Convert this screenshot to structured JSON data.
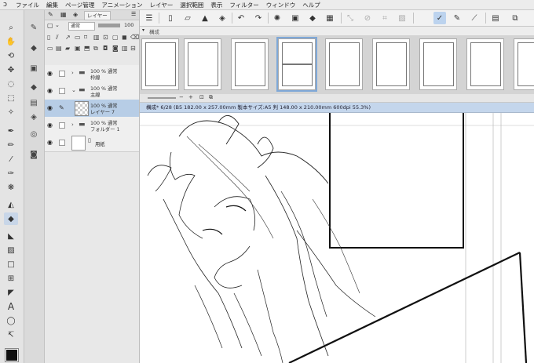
{
  "menu": [
    "ファイル",
    "編集",
    "ページ管理",
    "アニメーション",
    "レイヤー",
    "選択範囲",
    "表示",
    "フィルター",
    "ウィンドウ",
    "ヘルプ"
  ],
  "layer_panel": {
    "tab_label": "レイヤー",
    "blend_mode": "通常",
    "opacity": "100",
    "layers": [
      {
        "line1": "100 % 通常",
        "line2": "枠線",
        "type": "folder",
        "active": false
      },
      {
        "line1": "100 % 通常",
        "line2": "主線",
        "type": "folder",
        "active": false
      },
      {
        "line1": "100 % 通常",
        "line2": "レイヤー 7",
        "type": "raster",
        "active": true
      },
      {
        "line1": "100 % 通常",
        "line2": "フォルダー 1",
        "type": "folder",
        "active": false
      },
      {
        "line1": "",
        "line2": "用紙",
        "type": "paper",
        "active": false
      }
    ]
  },
  "page_manager": {
    "title": "構成"
  },
  "canvas": {
    "tab_title": "構成* 6/28 (B5 182.00 x 257.00mm 製本サイズ:A5 判 148.00 x 210.00mm 600dpi 55.3%)"
  },
  "colors": {
    "selection": "#b7cde6",
    "accent": "#7fa8d8",
    "main_color": "#111111"
  },
  "icons": {
    "toolbar": [
      "menu-icon",
      "new-file-icon",
      "open-icon",
      "save-icon",
      "export-icon",
      "undo-icon",
      "redo-icon",
      "spinner-icon",
      "layer-op-icon",
      "fill-icon",
      "transform-icon",
      "select-all-icon",
      "deselect-icon",
      "crop-icon",
      "ruler-pen-icon",
      "brush-icon",
      "stroke-icon",
      "snap-icon",
      "text-icon",
      "settings-icon"
    ],
    "tools": [
      "search-icon",
      "hand-icon",
      "rotate-icon",
      "move-icon",
      "lasso-icon",
      "select-icon",
      "eyedropper-icon",
      "pen-icon",
      "pencil-icon",
      "brush-icon",
      "airbrush-icon",
      "decorate-icon",
      "eraser-icon",
      "blend-icon",
      "fill-icon",
      "gradient-icon",
      "figure-icon",
      "frame-icon",
      "ruler-icon",
      "text-icon",
      "balloon-icon",
      "correct-line-icon"
    ]
  }
}
